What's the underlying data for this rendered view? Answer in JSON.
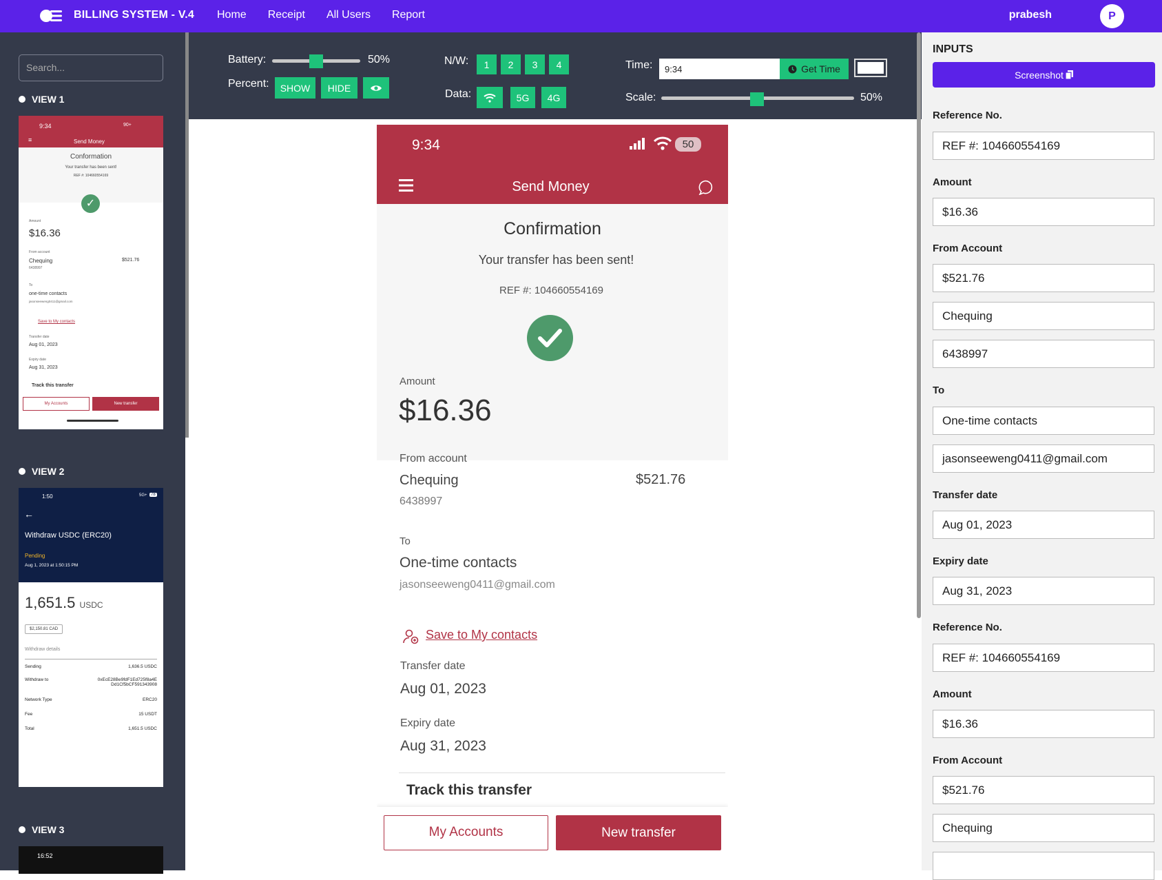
{
  "app": {
    "title": "BILLING SYSTEM - V.4",
    "user": "prabesh",
    "avatar_initial": "P"
  },
  "nav": {
    "items": [
      "Home",
      "Receipt",
      "All Users",
      "Report"
    ]
  },
  "sidebar": {
    "search_placeholder": "Search...",
    "views": [
      "VIEW 1",
      "VIEW 2",
      "VIEW 3"
    ],
    "view1": {
      "time": "9:34",
      "status": "90+",
      "header": "Send Money",
      "title": "Conformation",
      "subtitle": "Your transfer has been sent!",
      "ref": "REF #: 104660554169",
      "amount_label": "Amount",
      "amount": "$16.36",
      "from_label": "From account",
      "from_name": "Chequing",
      "from_balance": "$521.76",
      "from_number": "6438997",
      "to_label": "To",
      "to_name": "one-time contacts",
      "to_email": "jasonseeweng0411@gmail.com",
      "save_link": "Save to My contacts",
      "transfer_label": "Transfer date",
      "transfer_date": "Aug 01, 2023",
      "expiry_label": "Expiry date",
      "expiry_date": "Aug 31, 2023",
      "track": "Track this transfer",
      "btn_accounts": "My Accounts",
      "btn_new": "New transfer"
    },
    "view2": {
      "time": "1:50",
      "status": "5G+",
      "battery": "78",
      "title": "Withdraw USDC (ERC20)",
      "status_text": "Pending",
      "date": "Aug 1, 2023 at 1:50:15 PM",
      "amount": "1,651.5",
      "currency": "USDC",
      "cad": "$2,150.81 CAD",
      "details_title": "Withdraw details",
      "rows": [
        {
          "k": "Sending",
          "v": "1,636.5 USDC"
        },
        {
          "k": "Withdraw to",
          "v": "0xEcE28Be9fdF1Ed725f8a4E Dd1Cf5bCF591343908"
        },
        {
          "k": "Network Type",
          "v": "ERC20"
        },
        {
          "k": "Fee",
          "v": "15 USDT"
        },
        {
          "k": "Total",
          "v": "1,651.5 USDC"
        }
      ]
    },
    "view3": {
      "time": "16:52"
    }
  },
  "controls": {
    "battery_label": "Battery:",
    "battery_value": "50%",
    "battery_level": 0.5,
    "percent_label": "Percent:",
    "show": "SHOW",
    "hide": "HIDE",
    "nw_label": "N/W:",
    "nw_buttons": [
      "1",
      "2",
      "3",
      "4"
    ],
    "data_label": "Data:",
    "data_buttons": [
      "5G",
      "4G"
    ],
    "time_label": "Time:",
    "time_value": "9:34",
    "get_time": "Get Time",
    "scale_label": "Scale:",
    "scale_value": "50%",
    "scale_level": 0.5
  },
  "phone": {
    "time": "9:34",
    "battery": "50",
    "header": "Send Money",
    "title": "Confirmation",
    "subtitle": "Your transfer has been sent!",
    "ref": "REF #: 104660554169",
    "amount_label": "Amount",
    "amount": "$16.36",
    "from_label": "From account",
    "from_name": "Chequing",
    "from_balance": "$521.76",
    "from_number": "6438997",
    "to_label": "To",
    "to_name": "One-time contacts",
    "to_email": "jasonseeweng0411@gmail.com",
    "save_link": "Save to My contacts",
    "transfer_label": "Transfer date",
    "transfer_date": "Aug 01, 2023",
    "expiry_label": "Expiry date",
    "expiry_date": "Aug 31, 2023",
    "track": "Track this transfer",
    "btn_accounts": "My Accounts",
    "btn_new": "New transfer",
    "accent": "#b13346"
  },
  "inputs": {
    "title": "INPUTS",
    "screenshot": "Screenshot",
    "ref_label": "Reference No.",
    "ref": "REF #: 104660554169",
    "amount_label": "Amount",
    "amount": "$16.36",
    "from_label": "From Account",
    "from_balance": "$521.76",
    "from_name": "Chequing",
    "from_number": "6438997",
    "to_label": "To",
    "to_name": "One-time contacts",
    "to_email": "jasonseeweng0411@gmail.com",
    "transfer_label": "Transfer date",
    "transfer_date": "Aug 01, 2023",
    "expiry_label": "Expiry date",
    "expiry_date": "Aug 31, 2023",
    "ref2_label": "Reference No.",
    "ref2": "REF #: 104660554169",
    "amount2_label": "Amount",
    "amount2": "$16.36",
    "from2_label": "From Account",
    "from2_balance": "$521.76",
    "from2_name": "Chequing"
  },
  "colors": {
    "brand": "#5b22e8",
    "panel": "#343a4a",
    "green": "#1ec27a",
    "bank_red": "#b13346",
    "check_green": "#4e9a6b"
  }
}
